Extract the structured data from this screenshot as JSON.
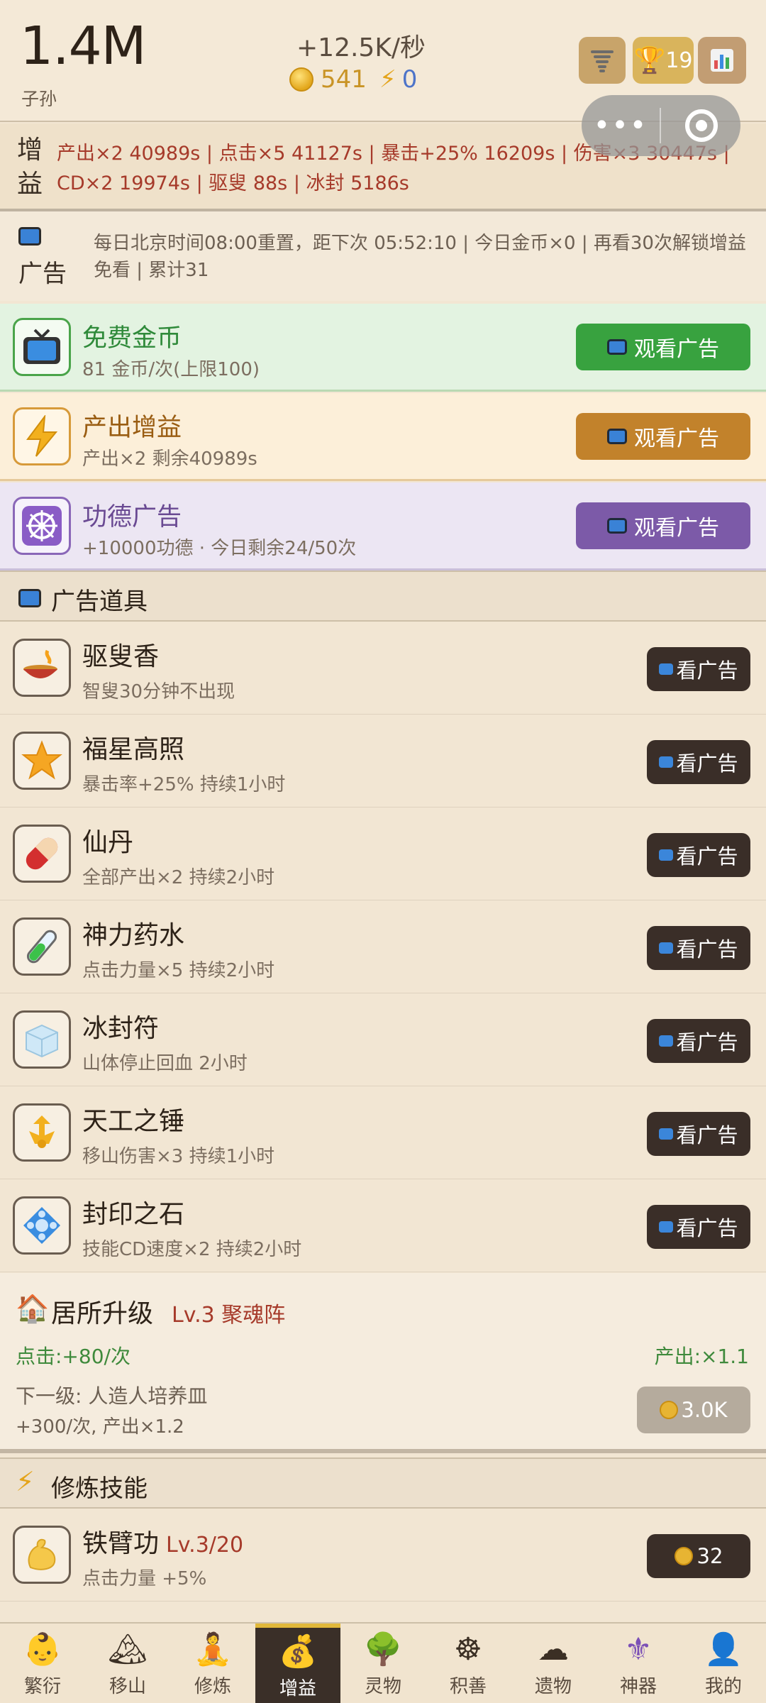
{
  "header": {
    "total": "1.4M",
    "total_label": "子孙",
    "rate": "+12.5K/秒",
    "coins": "541",
    "energy": "0",
    "trophy_count": "19"
  },
  "buff": {
    "tag": "增益",
    "text": "产出×2 40989s | 点击×5 41127s | 暴击+25% 16209s | 伤害×3 30447s | CD×2 19974s | 驱叟 88s | 冰封 5186s"
  },
  "ad_info": {
    "tag": "广告",
    "text": "每日北京时间08:00重置，距下次 05:52:10 | 今日金币×0 | 再看30次解锁增益免看 | 累计31"
  },
  "ad_cards": [
    {
      "title": "免费金币",
      "desc": "81 金币/次(上限100)",
      "button": "观看广告"
    },
    {
      "title": "产出增益",
      "desc": "产出×2 剩余40989s",
      "button": "观看广告"
    },
    {
      "title": "功德广告",
      "desc": "+10000功德 · 今日剩余24/50次",
      "button": "观看广告"
    }
  ],
  "ad_items_section": "广告道具",
  "ad_items": [
    {
      "name": "驱叟香",
      "desc": "智叟30分钟不出现",
      "button": "看广告",
      "icon": "incense-icon"
    },
    {
      "name": "福星高照",
      "desc": "暴击率+25% 持续1小时",
      "button": "看广告",
      "icon": "star-icon"
    },
    {
      "name": "仙丹",
      "desc": "全部产出×2 持续2小时",
      "button": "看广告",
      "icon": "pill-icon"
    },
    {
      "name": "神力药水",
      "desc": "点击力量×5 持续2小时",
      "button": "看广告",
      "icon": "potion-icon"
    },
    {
      "name": "冰封符",
      "desc": "山体停止回血 2小时",
      "button": "看广告",
      "icon": "ice-cube-icon"
    },
    {
      "name": "天工之锤",
      "desc": "移山伤害×3 持续1小时",
      "button": "看广告",
      "icon": "hammer-icon"
    },
    {
      "name": "封印之石",
      "desc": "技能CD速度×2 持续2小时",
      "button": "看广告",
      "icon": "seal-stone-icon"
    }
  ],
  "residence": {
    "title": "居所升级",
    "level": "Lv.3 聚魂阵",
    "click": "点击:+80/次",
    "production": "产出:×1.1",
    "next_level": "下一级: 人造人培养皿",
    "next_bonus": "+300/次, 产出×1.2",
    "cost": "3.0K"
  },
  "skills_section": "修炼技能",
  "skills": [
    {
      "name": "铁臂功",
      "level": "Lv.3/20",
      "desc": "点击力量 +5%",
      "cost": "32"
    }
  ],
  "nav": [
    {
      "label": "繁衍",
      "icon": "baby-icon",
      "active": false
    },
    {
      "label": "移山",
      "icon": "mountain-icon",
      "active": false
    },
    {
      "label": "修炼",
      "icon": "meditate-icon",
      "active": false
    },
    {
      "label": "增益",
      "icon": "money-bag-icon",
      "active": true
    },
    {
      "label": "灵物",
      "icon": "tree-icon",
      "active": false
    },
    {
      "label": "积善",
      "icon": "dharma-wheel-icon",
      "active": false
    },
    {
      "label": "遗物",
      "icon": "cloud-icon",
      "active": false
    },
    {
      "label": "神器",
      "icon": "fleur-icon",
      "active": false
    },
    {
      "label": "我的",
      "icon": "user-icon",
      "active": false
    }
  ]
}
